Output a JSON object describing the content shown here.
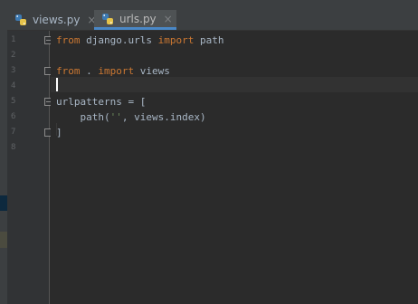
{
  "tabs": [
    {
      "label": "views.py",
      "close": "×",
      "active": false
    },
    {
      "label": "urls.py",
      "close": "×",
      "active": true
    }
  ],
  "line_numbers": [
    "1",
    "2",
    "3",
    "4",
    "5",
    "6",
    "7",
    "8"
  ],
  "code": {
    "line1": {
      "kw1": "from",
      "mid": " django.urls ",
      "kw2": "import",
      "rest": " path"
    },
    "line3": {
      "kw1": "from",
      "mid": " . ",
      "kw2": "import",
      "rest": " views"
    },
    "line5": {
      "text": "urlpatterns = ["
    },
    "line6": {
      "pre": "    path(",
      "str": "''",
      "post": ", views.index)"
    },
    "line7": {
      "text": "]"
    }
  },
  "colors": {
    "background": "#2b2b2b",
    "keyword": "#cc7832",
    "string": "#6a8759",
    "text": "#a9b7c6",
    "tab_accent": "#4a88c7"
  }
}
